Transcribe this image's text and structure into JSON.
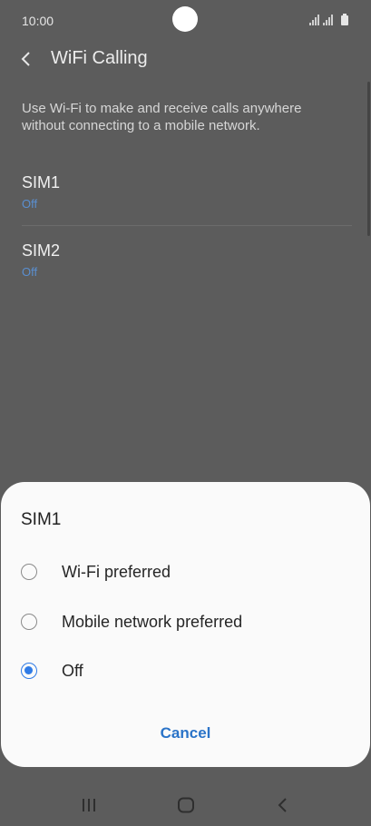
{
  "status_bar": {
    "time": "10:00",
    "icons": [
      "signal-sim1-icon",
      "signal-sim2-icon",
      "battery-icon"
    ]
  },
  "app_bar": {
    "title": "WiFi Calling",
    "back_icon": "chevron-left-icon"
  },
  "description": "Use Wi-Fi to make and receive calls anywhere without connecting to a mobile network.",
  "sims": [
    {
      "title": "SIM1",
      "status": "Off"
    },
    {
      "title": "SIM2",
      "status": "Off"
    }
  ],
  "dialog": {
    "title": "SIM1",
    "options": [
      {
        "label": "Wi-Fi preferred",
        "selected": false
      },
      {
        "label": "Mobile network preferred",
        "selected": false
      },
      {
        "label": "Off",
        "selected": true
      }
    ],
    "cancel_label": "Cancel"
  },
  "nav_bar": {
    "buttons": [
      "recent-apps-icon",
      "home-icon",
      "back-icon"
    ]
  },
  "colors": {
    "accent": "#2f7be6",
    "status_text": "#5a8fd0",
    "dim_background": "#5c5c5c",
    "dialog_background": "#fafafa"
  }
}
